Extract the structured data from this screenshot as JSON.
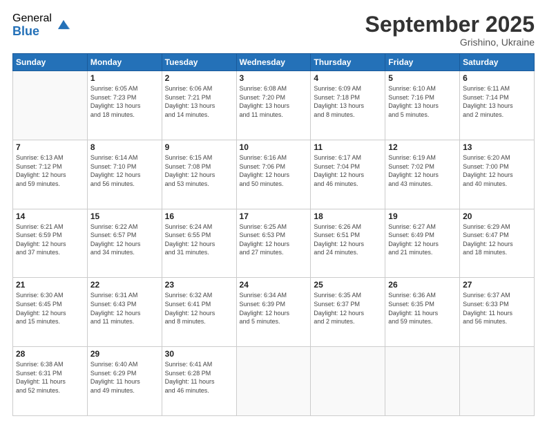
{
  "logo": {
    "general": "General",
    "blue": "Blue"
  },
  "header": {
    "month": "September 2025",
    "location": "Grishino, Ukraine"
  },
  "weekdays": [
    "Sunday",
    "Monday",
    "Tuesday",
    "Wednesday",
    "Thursday",
    "Friday",
    "Saturday"
  ],
  "weeks": [
    [
      {
        "day": "",
        "info": ""
      },
      {
        "day": "1",
        "info": "Sunrise: 6:05 AM\nSunset: 7:23 PM\nDaylight: 13 hours\nand 18 minutes."
      },
      {
        "day": "2",
        "info": "Sunrise: 6:06 AM\nSunset: 7:21 PM\nDaylight: 13 hours\nand 14 minutes."
      },
      {
        "day": "3",
        "info": "Sunrise: 6:08 AM\nSunset: 7:20 PM\nDaylight: 13 hours\nand 11 minutes."
      },
      {
        "day": "4",
        "info": "Sunrise: 6:09 AM\nSunset: 7:18 PM\nDaylight: 13 hours\nand 8 minutes."
      },
      {
        "day": "5",
        "info": "Sunrise: 6:10 AM\nSunset: 7:16 PM\nDaylight: 13 hours\nand 5 minutes."
      },
      {
        "day": "6",
        "info": "Sunrise: 6:11 AM\nSunset: 7:14 PM\nDaylight: 13 hours\nand 2 minutes."
      }
    ],
    [
      {
        "day": "7",
        "info": "Sunrise: 6:13 AM\nSunset: 7:12 PM\nDaylight: 12 hours\nand 59 minutes."
      },
      {
        "day": "8",
        "info": "Sunrise: 6:14 AM\nSunset: 7:10 PM\nDaylight: 12 hours\nand 56 minutes."
      },
      {
        "day": "9",
        "info": "Sunrise: 6:15 AM\nSunset: 7:08 PM\nDaylight: 12 hours\nand 53 minutes."
      },
      {
        "day": "10",
        "info": "Sunrise: 6:16 AM\nSunset: 7:06 PM\nDaylight: 12 hours\nand 50 minutes."
      },
      {
        "day": "11",
        "info": "Sunrise: 6:17 AM\nSunset: 7:04 PM\nDaylight: 12 hours\nand 46 minutes."
      },
      {
        "day": "12",
        "info": "Sunrise: 6:19 AM\nSunset: 7:02 PM\nDaylight: 12 hours\nand 43 minutes."
      },
      {
        "day": "13",
        "info": "Sunrise: 6:20 AM\nSunset: 7:00 PM\nDaylight: 12 hours\nand 40 minutes."
      }
    ],
    [
      {
        "day": "14",
        "info": "Sunrise: 6:21 AM\nSunset: 6:59 PM\nDaylight: 12 hours\nand 37 minutes."
      },
      {
        "day": "15",
        "info": "Sunrise: 6:22 AM\nSunset: 6:57 PM\nDaylight: 12 hours\nand 34 minutes."
      },
      {
        "day": "16",
        "info": "Sunrise: 6:24 AM\nSunset: 6:55 PM\nDaylight: 12 hours\nand 31 minutes."
      },
      {
        "day": "17",
        "info": "Sunrise: 6:25 AM\nSunset: 6:53 PM\nDaylight: 12 hours\nand 27 minutes."
      },
      {
        "day": "18",
        "info": "Sunrise: 6:26 AM\nSunset: 6:51 PM\nDaylight: 12 hours\nand 24 minutes."
      },
      {
        "day": "19",
        "info": "Sunrise: 6:27 AM\nSunset: 6:49 PM\nDaylight: 12 hours\nand 21 minutes."
      },
      {
        "day": "20",
        "info": "Sunrise: 6:29 AM\nSunset: 6:47 PM\nDaylight: 12 hours\nand 18 minutes."
      }
    ],
    [
      {
        "day": "21",
        "info": "Sunrise: 6:30 AM\nSunset: 6:45 PM\nDaylight: 12 hours\nand 15 minutes."
      },
      {
        "day": "22",
        "info": "Sunrise: 6:31 AM\nSunset: 6:43 PM\nDaylight: 12 hours\nand 11 minutes."
      },
      {
        "day": "23",
        "info": "Sunrise: 6:32 AM\nSunset: 6:41 PM\nDaylight: 12 hours\nand 8 minutes."
      },
      {
        "day": "24",
        "info": "Sunrise: 6:34 AM\nSunset: 6:39 PM\nDaylight: 12 hours\nand 5 minutes."
      },
      {
        "day": "25",
        "info": "Sunrise: 6:35 AM\nSunset: 6:37 PM\nDaylight: 12 hours\nand 2 minutes."
      },
      {
        "day": "26",
        "info": "Sunrise: 6:36 AM\nSunset: 6:35 PM\nDaylight: 11 hours\nand 59 minutes."
      },
      {
        "day": "27",
        "info": "Sunrise: 6:37 AM\nSunset: 6:33 PM\nDaylight: 11 hours\nand 56 minutes."
      }
    ],
    [
      {
        "day": "28",
        "info": "Sunrise: 6:38 AM\nSunset: 6:31 PM\nDaylight: 11 hours\nand 52 minutes."
      },
      {
        "day": "29",
        "info": "Sunrise: 6:40 AM\nSunset: 6:29 PM\nDaylight: 11 hours\nand 49 minutes."
      },
      {
        "day": "30",
        "info": "Sunrise: 6:41 AM\nSunset: 6:28 PM\nDaylight: 11 hours\nand 46 minutes."
      },
      {
        "day": "",
        "info": ""
      },
      {
        "day": "",
        "info": ""
      },
      {
        "day": "",
        "info": ""
      },
      {
        "day": "",
        "info": ""
      }
    ]
  ]
}
